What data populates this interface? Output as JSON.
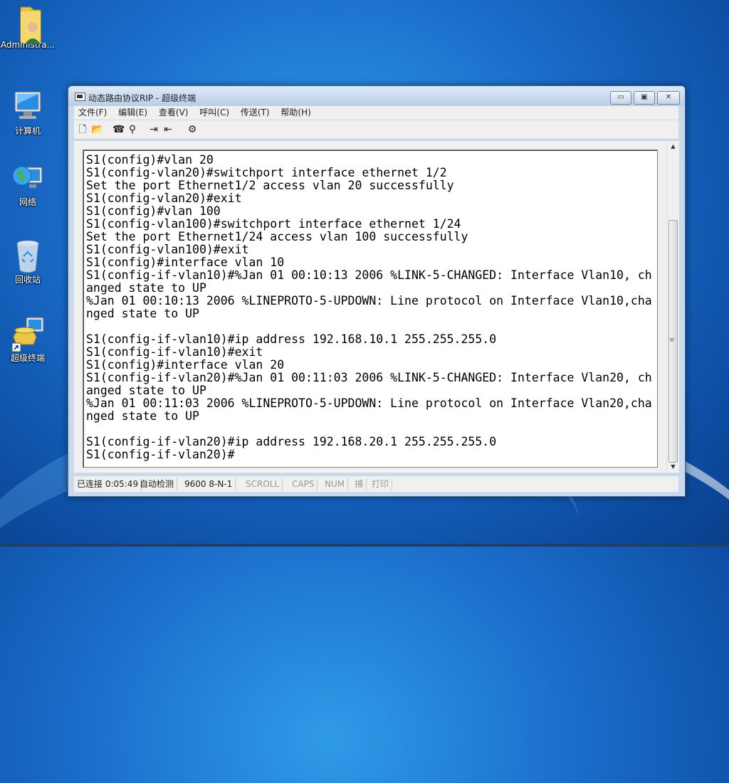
{
  "desktop": {
    "icons": [
      {
        "label": "Administra...",
        "icon": "user-folder-icon"
      },
      {
        "label": "计算机",
        "icon": "computer-icon"
      },
      {
        "label": "网络",
        "icon": "network-icon"
      },
      {
        "label": "回收站",
        "icon": "recycle-bin-icon"
      },
      {
        "label": "超级终端",
        "icon": "hyperterminal-shortcut-icon"
      }
    ]
  },
  "window": {
    "title": "动态路由协议RIP - 超级终端",
    "buttons": {
      "min": "▭",
      "max": "▣",
      "close": "✕"
    },
    "menu": [
      "文件(F)",
      "编辑(E)",
      "查看(V)",
      "呼叫(C)",
      "传送(T)",
      "帮助(H)"
    ],
    "toolbar": {
      "new": "🗋",
      "open": "📂",
      "connect": "☎",
      "disconnect": "⚲",
      "send": "⇥",
      "receive": "⇤",
      "properties": "⚙"
    }
  },
  "terminal": {
    "lines": [
      "S1(config)#vlan 20",
      "S1(config-vlan20)#switchport interface ethernet 1/2",
      "Set the port Ethernet1/2 access vlan 20 successfully",
      "S1(config-vlan20)#exit",
      "S1(config)#vlan 100",
      "S1(config-vlan100)#switchport interface ethernet 1/24",
      "Set the port Ethernet1/24 access vlan 100 successfully",
      "S1(config-vlan100)#exit",
      "S1(config)#interface vlan 10",
      "S1(config-if-vlan10)#%Jan 01 00:10:13 2006 %LINK-5-CHANGED: Interface Vlan10, ch",
      "anged state to UP",
      "%Jan 01 00:10:13 2006 %LINEPROTO-5-UPDOWN: Line protocol on Interface Vlan10,cha",
      "nged state to UP",
      "",
      "S1(config-if-vlan10)#ip address 192.168.10.1 255.255.255.0",
      "S1(config-if-vlan10)#exit",
      "S1(config)#interface vlan 20",
      "S1(config-if-vlan20)#%Jan 01 00:11:03 2006 %LINK-5-CHANGED: Interface Vlan20, ch",
      "anged state to UP",
      "%Jan 01 00:11:03 2006 %LINEPROTO-5-UPDOWN: Line protocol on Interface Vlan20,cha",
      "nged state to UP",
      "",
      "S1(config-if-vlan20)#ip address 192.168.20.1 255.255.255.0",
      "S1(config-if-vlan20)#"
    ]
  },
  "status": {
    "connected": "已连接 0:05:49",
    "detect": "自动检测",
    "settings": "9600 8-N-1",
    "scroll": "SCROLL",
    "caps": "CAPS",
    "num": "NUM",
    "capture": "捕",
    "print": "打印"
  }
}
